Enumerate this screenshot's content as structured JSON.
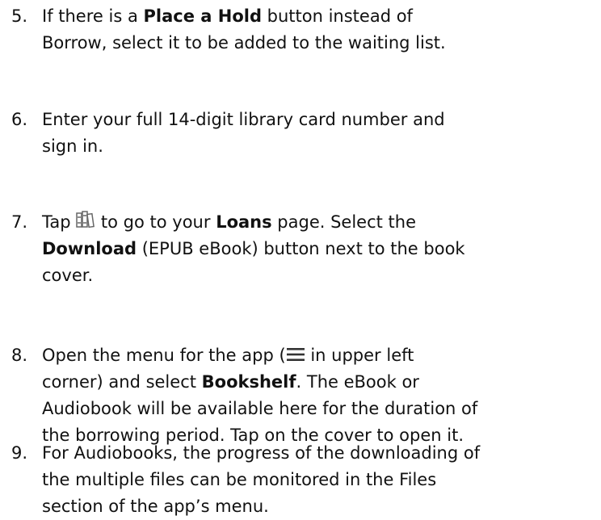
{
  "steps": [
    {
      "number": "5.",
      "lines": [
        [
          "If there is a ",
          {
            "b": "Place a Hold"
          },
          " button instead of"
        ],
        [
          "Borrow, select it to be added to the waiting list."
        ]
      ]
    },
    {
      "number": "6.",
      "lines": [
        [
          "Enter your full 14-digit library card number and"
        ],
        [
          "sign in."
        ]
      ]
    },
    {
      "number": "7.",
      "lines": [
        [
          "Tap ",
          {
            "icon": "loans-books-icon"
          },
          " to go to your ",
          {
            "b": "Loans"
          },
          " page. Select the"
        ],
        [
          {
            "b": "Download"
          },
          " (EPUB eBook) button next to the book"
        ],
        [
          "cover."
        ]
      ]
    },
    {
      "number": "8.",
      "lines": [
        [
          "Open the menu for the app (",
          {
            "icon": "hamburger-menu-icon"
          },
          " in upper left"
        ],
        [
          "corner) and select ",
          {
            "b": "Bookshelf"
          },
          ". The eBook or"
        ],
        [
          "Audiobook will be available here for the duration of"
        ],
        [
          "the borrowing period. Tap on the cover to open it."
        ]
      ]
    },
    {
      "number": "9.",
      "lines": [
        [
          "For Audiobooks, the progress of the downloading of"
        ],
        [
          "the multiple files can be monitored in the Files"
        ],
        [
          "section of the app’s menu."
        ]
      ]
    }
  ]
}
